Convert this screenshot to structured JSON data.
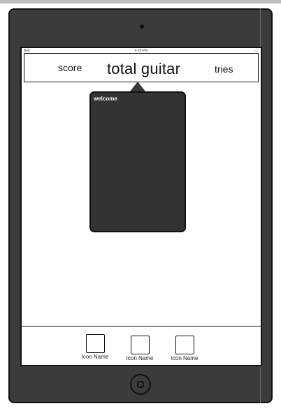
{
  "status_bar": {
    "carrier": "Bell",
    "time": "4:20 PM",
    "battery": "▭"
  },
  "header": {
    "score_label": "score",
    "title": "total guitar",
    "tries_label": "tries"
  },
  "popover": {
    "text": "welcome"
  },
  "tab_bar": {
    "items": [
      {
        "label": "Icon Name"
      },
      {
        "label": "Icon Name"
      },
      {
        "label": "Icon Name"
      }
    ]
  },
  "colors": {
    "device": "#3b3b3b",
    "popover": "#333333",
    "screen": "#ffffff"
  },
  "icons": {
    "home": "home-button-icon",
    "camera": "camera-icon"
  }
}
